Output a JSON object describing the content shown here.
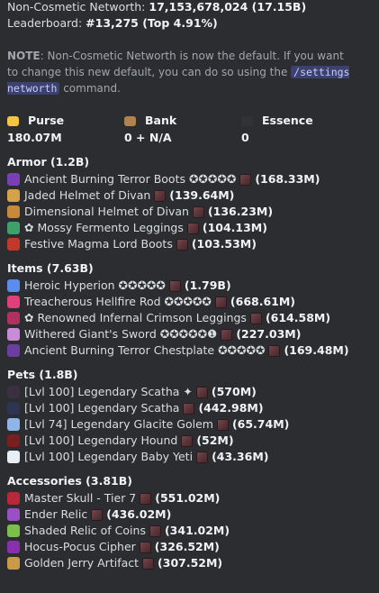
{
  "header": {
    "networth_label": "Non-Cosmetic Networth:",
    "networth_value": "17,153,678,024 (17.15B)",
    "leaderboard_label": "Leaderboard:",
    "leaderboard_value": "#13,275 (Top 4.91%)"
  },
  "note": {
    "label": "NOTE",
    "text1": ": Non-Cosmetic Networth is now the default. If you want to change this new default, you can do so using the ",
    "command": "/settings networth",
    "text2": " command."
  },
  "stats": [
    {
      "icon": "gold-bar-icon",
      "label": "Purse",
      "value": "180.07M",
      "color": "#f5c542"
    },
    {
      "icon": "chest-icon",
      "label": "Bank",
      "value": "0 + N/A",
      "color": "#b08450"
    },
    {
      "icon": "wither-essence-icon",
      "label": "Essence",
      "value": "0",
      "color": "#333"
    }
  ],
  "sections": [
    {
      "name": "armor",
      "title": "Armor (1.2B)",
      "items": [
        {
          "icon": "boots-icon",
          "color": "#7b3fb5",
          "text": "Ancient Burning Terror Boots ✪✪✪✪✪",
          "value": "(168.33M)"
        },
        {
          "icon": "helmet-icon",
          "color": "#d5a24a",
          "text": "Jaded Helmet of Divan",
          "value": "(139.64M)"
        },
        {
          "icon": "helmet-icon",
          "color": "#c7893b",
          "text": "Dimensional Helmet of Divan",
          "value": "(136.23M)"
        },
        {
          "icon": "leggings-icon",
          "color": "#3fa06a",
          "text": "✿ Mossy Fermento Leggings",
          "value": "(104.13M)"
        },
        {
          "icon": "boots-icon",
          "color": "#c0392b",
          "text": "Festive Magma Lord Boots",
          "value": "(103.53M)"
        }
      ]
    },
    {
      "name": "items",
      "title": "Items (7.63B)",
      "items": [
        {
          "icon": "sword-icon",
          "color": "#5b8def",
          "text": "Heroic Hyperion ✪✪✪✪✪",
          "value": "(1.79B)"
        },
        {
          "icon": "rod-icon",
          "color": "#e0407a",
          "text": "Treacherous Hellfire Rod ✪✪✪✪✪",
          "value": "(668.61M)"
        },
        {
          "icon": "leggings-icon",
          "color": "#b03060",
          "text": "✿ Renowned Infernal Crimson Leggings",
          "value": "(614.58M)"
        },
        {
          "icon": "sword-icon",
          "color": "#c98ad8",
          "text": "Withered Giant's Sword ✪✪✪✪✪❶",
          "value": "(227.03M)"
        },
        {
          "icon": "chestplate-icon",
          "color": "#6a3fa0",
          "text": "Ancient Burning Terror Chestplate ✪✪✪✪✪",
          "value": "(169.48M)"
        }
      ]
    },
    {
      "name": "pets",
      "title": "Pets (1.8B)",
      "items": [
        {
          "icon": "scatha-icon",
          "color": "#3a3040",
          "text": "[Lvl 100] Legendary Scatha ✦",
          "value": "(570M)"
        },
        {
          "icon": "scatha-icon",
          "color": "#2e3550",
          "text": "[Lvl 100] Legendary Scatha",
          "value": "(442.98M)"
        },
        {
          "icon": "golem-icon",
          "color": "#8fb4e8",
          "text": "[Lvl 74] Legendary Glacite Golem",
          "value": "(65.74M)"
        },
        {
          "icon": "hound-icon",
          "color": "#7a1f1f",
          "text": "[Lvl 100] Legendary Hound",
          "value": "(52M)"
        },
        {
          "icon": "yeti-icon",
          "color": "#e8eef5",
          "text": "[Lvl 100] Legendary Baby Yeti",
          "value": "(43.36M)"
        }
      ]
    },
    {
      "name": "accessories",
      "title": "Accessories (3.81B)",
      "items": [
        {
          "icon": "skull-icon",
          "color": "#b8283a",
          "text": "Master Skull - Tier 7",
          "value": "(551.02M)"
        },
        {
          "icon": "relic-icon",
          "color": "#9b4fc4",
          "text": "Ender Relic",
          "value": "(436.02M)"
        },
        {
          "icon": "relic-icon",
          "color": "#7cbf4a",
          "text": "Shaded Relic of Coins",
          "value": "(341.02M)"
        },
        {
          "icon": "cipher-icon",
          "color": "#8a2fb0",
          "text": "Hocus-Pocus Cipher",
          "value": "(326.52M)"
        },
        {
          "icon": "artifact-icon",
          "color": "#c99a4a",
          "text": "Golden Jerry Artifact",
          "value": "(307.52M)"
        }
      ]
    }
  ]
}
